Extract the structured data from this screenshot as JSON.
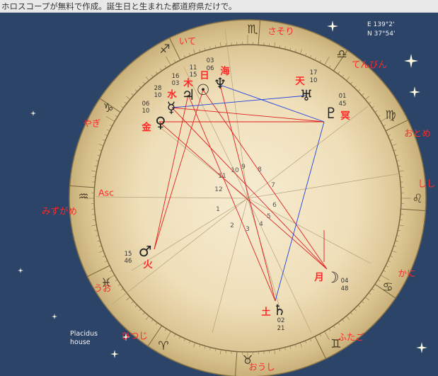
{
  "header": {
    "text": "ホロスコープが無料で作成。誕生日と生まれた都道府県だけで。"
  },
  "coords": {
    "lon": "E 139°2'",
    "lat": "N 37°54'"
  },
  "house_system": {
    "line1": "Placidus",
    "line2": "house"
  },
  "colors": {
    "background": "#2c4468",
    "wheel_outer": "#d8c48f",
    "wheel_inner": "#f2e5c4",
    "sign_label": "#ff2a2a",
    "planet_label": "#ff2a2a",
    "aspect_red": "#e02020",
    "aspect_blue": "#2040e0"
  },
  "zodiac": [
    {
      "label": "さそり",
      "glyph": "♏",
      "icon": "scorpio-icon"
    },
    {
      "label": "てんびん",
      "glyph": "♎",
      "icon": "libra-icon"
    },
    {
      "label": "おとめ",
      "glyph": "♍",
      "icon": "virgo-icon"
    },
    {
      "label": "しし",
      "glyph": "♌",
      "icon": "leo-icon"
    },
    {
      "label": "かに",
      "glyph": "♋",
      "icon": "cancer-icon"
    },
    {
      "label": "ふたご",
      "glyph": "♊",
      "icon": "gemini-icon"
    },
    {
      "label": "おうし",
      "glyph": "♉",
      "icon": "taurus-icon"
    },
    {
      "label": "ひつじ",
      "glyph": "♈",
      "icon": "aries-icon"
    },
    {
      "label": "うお",
      "glyph": "♓",
      "icon": "pisces-icon"
    },
    {
      "label": "みずがめ",
      "glyph": "♒",
      "icon": "aquarius-icon"
    },
    {
      "label": "やぎ",
      "glyph": "♑",
      "icon": "capricorn-icon"
    },
    {
      "label": "いて",
      "glyph": "♐",
      "icon": "sagittarius-icon"
    }
  ],
  "asc_label": "Asc",
  "houses": [
    "1",
    "2",
    "3",
    "4",
    "5",
    "6",
    "7",
    "8",
    "9",
    "10",
    "11",
    "12"
  ],
  "planets": [
    {
      "id": "sun",
      "name": "日",
      "glyph": "☉",
      "deg": "11",
      "min": "15",
      "icon": "sun-icon"
    },
    {
      "id": "moon",
      "name": "月",
      "glyph": "☽",
      "deg": "04",
      "min": "48",
      "icon": "moon-icon"
    },
    {
      "id": "mercury",
      "name": "水",
      "glyph": "☿",
      "deg": "06",
      "min": "10",
      "icon": "mercury-icon"
    },
    {
      "id": "venus",
      "name": "金",
      "glyph": "♀",
      "deg": "",
      "min": "",
      "icon": "venus-icon"
    },
    {
      "id": "mars",
      "name": "火",
      "glyph": "♂",
      "deg": "15",
      "min": "46",
      "icon": "mars-icon"
    },
    {
      "id": "jupiter",
      "name": "木",
      "glyph": "♃",
      "deg": "16",
      "min": "03",
      "icon": "jupiter-icon"
    },
    {
      "id": "saturn",
      "name": "土",
      "glyph": "♄",
      "deg": "02",
      "min": "21",
      "icon": "saturn-icon"
    },
    {
      "id": "uranus",
      "name": "天",
      "glyph": "♅",
      "deg": "17",
      "min": "10",
      "icon": "uranus-icon"
    },
    {
      "id": "neptune",
      "name": "海",
      "glyph": "♆",
      "deg": "03",
      "min": "06",
      "icon": "neptune-icon"
    },
    {
      "id": "pluto",
      "name": "冥",
      "glyph": "♇",
      "deg": "01",
      "min": "45",
      "icon": "pluto-icon"
    }
  ],
  "extra_degrees": [
    {
      "deg": "28",
      "min": "10"
    }
  ]
}
